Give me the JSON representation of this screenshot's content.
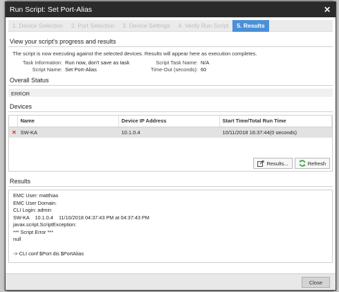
{
  "window": {
    "title": "Run Script: Set Port-Alias"
  },
  "steps": [
    {
      "label": "1. Device Selection"
    },
    {
      "label": "2. Port Selection"
    },
    {
      "label": "3. Device Settings"
    },
    {
      "label": "4. Verify Run Script"
    },
    {
      "label": "5. Results"
    }
  ],
  "progress": {
    "title": "View your script's progress and results",
    "note": "The script is now executing against the selected devices. Results will appear here as execution completes.",
    "task_info_label": "Task Information:",
    "task_info_value": "Run now, don't save as task",
    "script_name_label": "Script Name:",
    "script_name_value": "Set Port-Alias",
    "task_name_label": "Script Task Name:",
    "task_name_value": "N/A",
    "timeout_label": "Time-Out (seconds):",
    "timeout_value": "60"
  },
  "overall_status": {
    "title": "Overall Status",
    "value": "ERROR"
  },
  "devices": {
    "title": "Devices",
    "columns": [
      "Name",
      "Device IP Address",
      "Start Time/Total Run Time"
    ],
    "rows": [
      {
        "status_mark": "✕",
        "name": "SW-KA",
        "ip": "10.1.0.4",
        "time": "10/11/2018 16:37:44(0 seconds)"
      }
    ],
    "results_button": "Results...",
    "refresh_button": "Refresh"
  },
  "results": {
    "title": "Results",
    "lines": [
      "EMC User: matthias",
      "EMC User Domain:",
      "CLI Login: admin",
      "SW-KA    10.1.0.4    11/10/2018 04:37:43 PM at 04:37:43 PM",
      "javax.script.ScriptException:",
      "*** Script Error ***",
      "null",
      "",
      "-> CLI conf $Port dis $PortAlias"
    ]
  },
  "footer": {
    "close_button": "Close"
  },
  "colors": {
    "titlebar": "#2b2b2b",
    "active_step": "#4a90d9",
    "error": "#d32f2f",
    "refresh_icon": "#2e9e3e"
  }
}
